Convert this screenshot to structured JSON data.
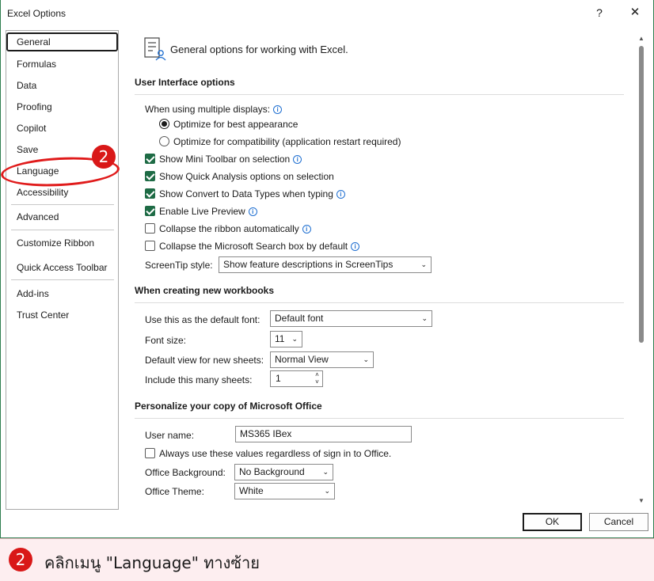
{
  "window": {
    "title": "Excel Options",
    "help_label": "?",
    "close_label": "✕"
  },
  "sidebar": {
    "items": [
      {
        "label": "General"
      },
      {
        "label": "Formulas"
      },
      {
        "label": "Data"
      },
      {
        "label": "Proofing"
      },
      {
        "label": "Copilot"
      },
      {
        "label": "Save"
      },
      {
        "label": "Language"
      },
      {
        "label": "Accessibility"
      },
      {
        "label": "Advanced"
      },
      {
        "label": "Customize Ribbon"
      },
      {
        "label": "Quick Access Toolbar"
      },
      {
        "label": "Add-ins"
      },
      {
        "label": "Trust Center"
      }
    ],
    "selected": "General"
  },
  "main": {
    "header": "General options for working with Excel.",
    "ui_section": {
      "title": "User Interface options",
      "multiple_displays_label": "When using multiple displays:",
      "radio_best_appearance": "Optimize for best appearance",
      "radio_compatibility": "Optimize for compatibility (application restart required)",
      "show_mini_toolbar": "Show Mini Toolbar on selection",
      "show_quick_analysis": "Show Quick Analysis options on selection",
      "show_convert_data_types": "Show Convert to Data Types when typing",
      "enable_live_preview": "Enable Live Preview",
      "collapse_ribbon": "Collapse the ribbon automatically",
      "collapse_search": "Collapse the Microsoft Search box by default",
      "screentip_label": "ScreenTip style:",
      "screentip_value": "Show feature descriptions in ScreenTips"
    },
    "workbooks_section": {
      "title": "When creating new workbooks",
      "default_font_label": "Use this as the default font:",
      "default_font_value": "Default font",
      "font_size_label": "Font size:",
      "font_size_value": "11",
      "default_view_label": "Default view for new sheets:",
      "default_view_value": "Normal View",
      "sheets_label": "Include this many sheets:",
      "sheets_value": "1"
    },
    "personalize_section": {
      "title": "Personalize your copy of Microsoft Office",
      "user_name_label": "User name:",
      "user_name_value": "MS365 IBex",
      "always_use_label": "Always use these values regardless of sign in to Office.",
      "background_label": "Office Background:",
      "background_value": "No Background",
      "theme_label": "Office Theme:",
      "theme_value": "White"
    }
  },
  "buttons": {
    "ok": "OK",
    "cancel": "Cancel"
  },
  "annotation": {
    "sidebar_badge": "2",
    "footer_badge": "2",
    "footer_text": "คลิกเมนู \"Language\" ทางซ้าย"
  },
  "colors": {
    "accent_green": "#1e6b45",
    "callout_red": "#e01b1b",
    "footer_bg": "#fdeef0"
  }
}
